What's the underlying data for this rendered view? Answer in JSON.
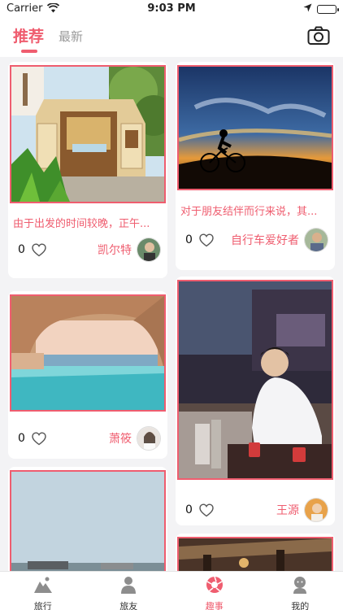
{
  "status_bar": {
    "carrier": "Carrier",
    "time": "9:03 PM"
  },
  "header": {
    "tab_recommend": "推荐",
    "tab_latest": "最新",
    "camera_icon": "camera-icon"
  },
  "feed": {
    "cards": [
      {
        "caption": "由于出发的时间较晚，正午...",
        "likes": "0",
        "author": "凯尔特"
      },
      {
        "caption": "对于朋友结伴而行来说，其...",
        "likes": "0",
        "author": "自行车爱好者"
      },
      {
        "caption": "",
        "likes": "0",
        "author": "萧筱"
      },
      {
        "caption": "",
        "likes": "0",
        "author": "王源"
      }
    ]
  },
  "tabbar": {
    "items": [
      {
        "label": "旅行",
        "icon": "travel-icon"
      },
      {
        "label": "旅友",
        "icon": "friends-icon"
      },
      {
        "label": "趣事",
        "icon": "fun-icon"
      },
      {
        "label": "我的",
        "icon": "profile-icon"
      }
    ],
    "active_index": 2
  },
  "colors": {
    "accent": "#ef5d6f",
    "background": "#f3f3f5"
  }
}
